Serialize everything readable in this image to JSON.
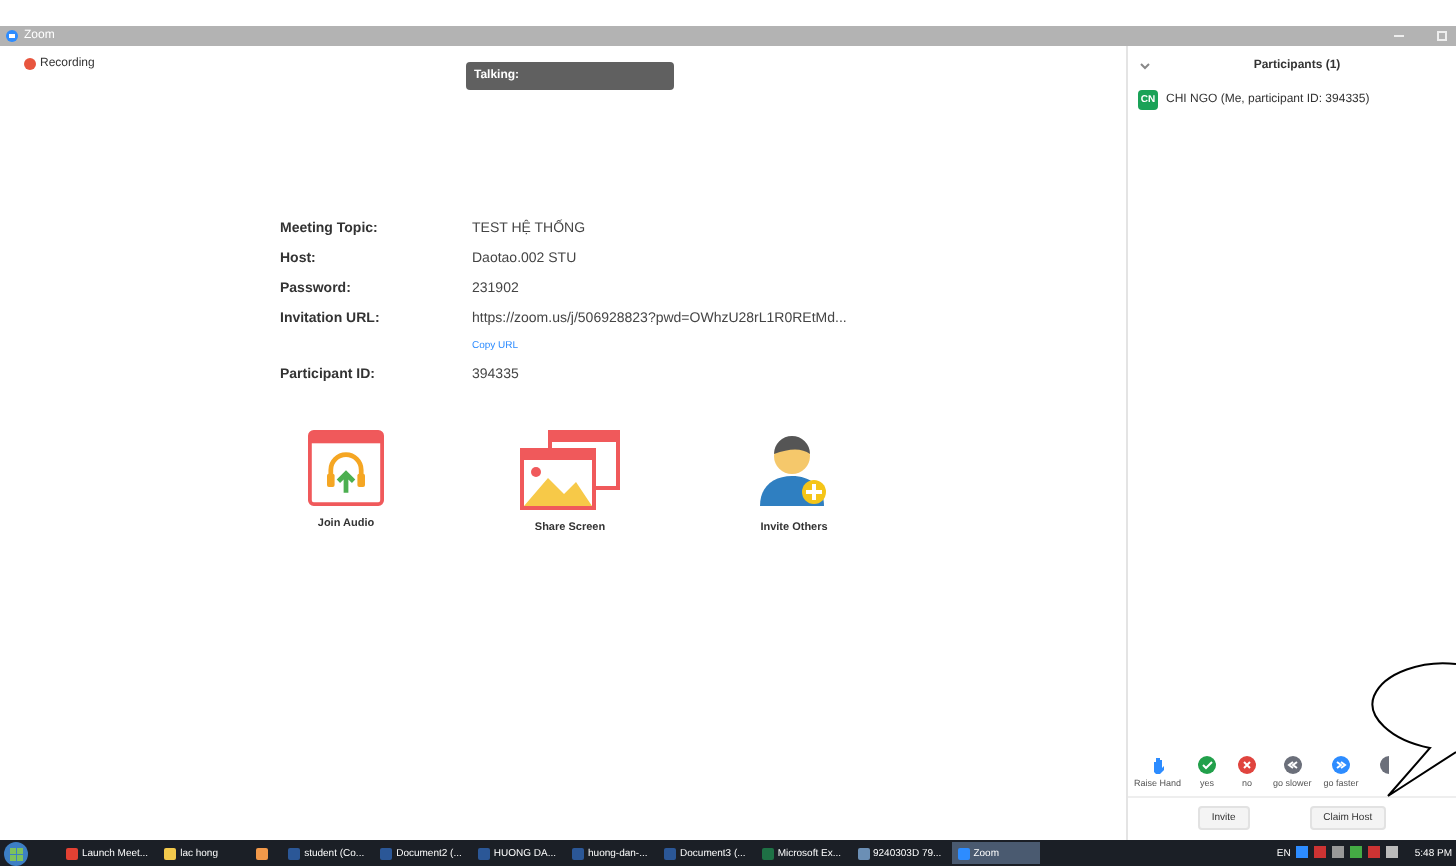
{
  "window": {
    "title": "Zoom"
  },
  "recording": {
    "label": "Recording"
  },
  "talking": {
    "label": "Talking:"
  },
  "meeting_info": [
    {
      "label": "Meeting Topic:",
      "value": "TEST HỆ THỐNG"
    },
    {
      "label": "Host:",
      "value": "Daotao.002 STU"
    },
    {
      "label": "Password:",
      "value": "231902"
    },
    {
      "label": "Invitation URL:",
      "value": "https://zoom.us/j/506928823?pwd=OWhzU28rL1R0REtMd...",
      "link": "Copy URL"
    },
    {
      "label": "Participant ID:",
      "value": "394335"
    }
  ],
  "actions": [
    {
      "kind": "audio",
      "label": "Join Audio"
    },
    {
      "kind": "share",
      "label": "Share Screen"
    },
    {
      "kind": "invite",
      "label": "Invite Others"
    }
  ],
  "participants": {
    "title": "Participants (1)",
    "items": [
      {
        "initials": "CN",
        "name": "CHI NGO (Me, participant ID: 394335)",
        "color": "#1aa257"
      }
    ]
  },
  "reactions": [
    {
      "kind": "hand",
      "label": "Raise Hand"
    },
    {
      "kind": "yes",
      "label": "yes"
    },
    {
      "kind": "no",
      "label": "no"
    },
    {
      "kind": "slower",
      "label": "go slower"
    },
    {
      "kind": "faster",
      "label": "go faster"
    },
    {
      "kind": "more"
    }
  ],
  "panel_buttons": [
    "Invite",
    "Claim Host"
  ],
  "taskbar": {
    "items": [
      {
        "kind": "chrome",
        "label": "Launch Meet...",
        "selected": false
      },
      {
        "kind": "folder",
        "label": "lac hong",
        "selected": false
      },
      {
        "kind": "media",
        "selected": false
      },
      {
        "kind": "word",
        "label": "student (Co...",
        "selected": false
      },
      {
        "kind": "word",
        "label": "Document2 (...",
        "selected": false
      },
      {
        "kind": "word",
        "label": "HUONG DA...",
        "selected": false
      },
      {
        "kind": "word",
        "label": "huong-dan-...",
        "selected": false
      },
      {
        "kind": "word",
        "label": "Document3 (...",
        "selected": false
      },
      {
        "kind": "excel",
        "label": "Microsoft Ex...",
        "selected": false
      },
      {
        "kind": "doc",
        "label": "9240303D 79...",
        "selected": false
      },
      {
        "kind": "zoom",
        "label": "Zoom",
        "selected": true
      }
    ],
    "language": "EN",
    "clock": "5:48 PM"
  }
}
